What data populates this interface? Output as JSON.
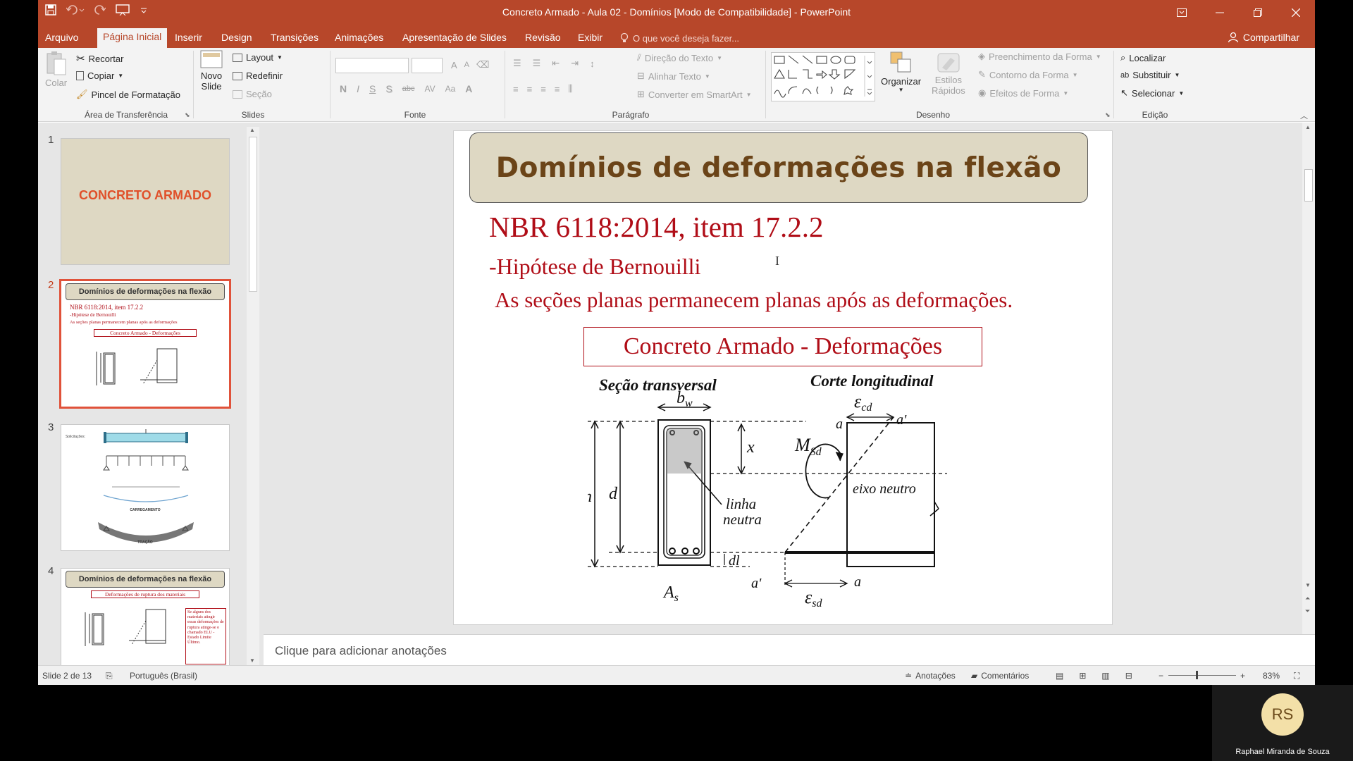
{
  "window": {
    "title": "Concreto Armado - Aula 02 - Domínios [Modo de Compatibilidade] - PowerPoint"
  },
  "tabs": [
    {
      "label": "Arquivo"
    },
    {
      "label": "Página Inicial"
    },
    {
      "label": "Inserir"
    },
    {
      "label": "Design"
    },
    {
      "label": "Transições"
    },
    {
      "label": "Animações"
    },
    {
      "label": "Apresentação de Slides"
    },
    {
      "label": "Revisão"
    },
    {
      "label": "Exibir"
    }
  ],
  "tell_me": "O que você deseja fazer...",
  "share": "Compartilhar",
  "ribbon": {
    "clipboard": {
      "paste": "Colar",
      "cut": "Recortar",
      "copy": "Copiar",
      "format_painter": "Pincel de Formatação",
      "label": "Área de Transferência"
    },
    "slides": {
      "new_slide_1": "Novo",
      "new_slide_2": "Slide",
      "layout": "Layout",
      "reset": "Redefinir",
      "section": "Seção",
      "label": "Slides"
    },
    "font": {
      "bold": "N",
      "italic": "I",
      "underline": "S",
      "shadow": "S",
      "strike": "abc",
      "spacing": "AV",
      "case": "Aa",
      "label": "Fonte"
    },
    "paragraph": {
      "text_direction": "Direção do Texto",
      "align_text": "Alinhar Texto",
      "smartart": "Converter em SmartArt",
      "label": "Parágrafo"
    },
    "drawing": {
      "arrange": "Organizar",
      "quick_styles_1": "Estilos",
      "quick_styles_2": "Rápidos",
      "shape_fill": "Preenchimento da Forma",
      "shape_outline": "Contorno da Forma",
      "shape_effects": "Efeitos de Forma",
      "label": "Desenho"
    },
    "editing": {
      "find": "Localizar",
      "replace": "Substituir",
      "select": "Selecionar",
      "label": "Edição"
    }
  },
  "thumbnails": [
    {
      "num": "1",
      "title": "CONCRETO ARMADO"
    },
    {
      "num": "2",
      "title": "Domínios de deformações na flexão",
      "lines": [
        "NBR 6118:2014, item 17.2.2",
        "-Hipótese de Bernouilli",
        "As seções planas permanecem planas após as deformações",
        "Concreto Armado - Deformações"
      ]
    },
    {
      "num": "3",
      "labels": [
        "Solicitações:",
        "CARREGAMENTO",
        "COMPRESSÃO",
        "TRAÇÃO"
      ]
    },
    {
      "num": "4",
      "title": "Domínios de deformações na flexão",
      "subtitle": "Deformações de ruptura dos materiais",
      "note": "Se alguns dos materiais atingir essas deformações de ruptura atinge-se o chamado ELU - Estado Limite Último."
    }
  ],
  "slide": {
    "title": "Domínios de deformações na flexão",
    "line1": "NBR 6118:2014, item 17.2.2",
    "line2": "-Hipótese de Bernouilli",
    "line3": "As seções planas permanecem planas após as deformações.",
    "box_title": "Concreto Armado - Deformações",
    "diagram": {
      "left_title": "Seção transversal",
      "right_title": "Corte longitudinal",
      "bw": "b",
      "bw_sub": "w",
      "h": "h",
      "d": "d",
      "x": "x",
      "dl": "dl",
      "as": "A",
      "as_sub": "s",
      "neutral_1": "linha",
      "neutral_2": "neutra",
      "msd": "M",
      "msd_sub": "Sd",
      "ecd": "ε",
      "ecd_sub": "cd",
      "esd": "ε",
      "esd_sub": "sd",
      "a": "a",
      "a_prime": "a'",
      "neutral_axis": "eixo neutro"
    }
  },
  "notes_placeholder": "Clique para adicionar anotações",
  "status": {
    "slide": "Slide 2 de 13",
    "language": "Português (Brasil)",
    "notes": "Anotações",
    "comments": "Comentários",
    "zoom": "83%"
  },
  "zoom_level": 0.83,
  "participant": {
    "initials": "RS",
    "name": "Raphael Miranda de Souza"
  },
  "colors": {
    "accent": "#b7472a",
    "slide_red": "#b00d17",
    "title_brown": "#6b4418",
    "banner": "#ded8c3"
  }
}
